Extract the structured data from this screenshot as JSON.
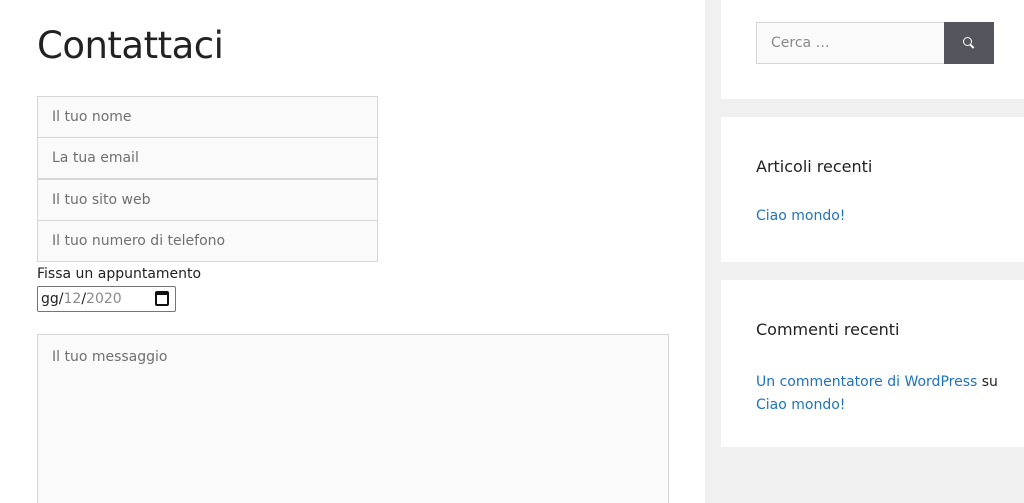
{
  "main": {
    "title": "Contattaci",
    "fields": {
      "name_placeholder": "Il tuo nome",
      "email_placeholder": "La tua email",
      "website_placeholder": "Il tuo sito web",
      "phone_placeholder": "Il tuo numero di telefono"
    },
    "appointment": {
      "label": "Fissa un appuntamento",
      "day": "gg",
      "separator": "/",
      "month": "12",
      "year": "2020",
      "icon": "calendar-icon"
    },
    "message_placeholder": "Il tuo messaggio"
  },
  "sidebar": {
    "search": {
      "placeholder": "Cerca …",
      "button_icon": "search-icon",
      "button_color": "#55555e"
    },
    "recent_articles": {
      "title": "Articoli recenti",
      "items": [
        "Ciao mondo!"
      ]
    },
    "recent_comments": {
      "title": "Commenti recenti",
      "author": "Un commentatore di WordPress",
      "connector": "su",
      "post": "Ciao mondo!"
    }
  },
  "colors": {
    "link": "#1e73be",
    "background": "#f0f0f0"
  }
}
